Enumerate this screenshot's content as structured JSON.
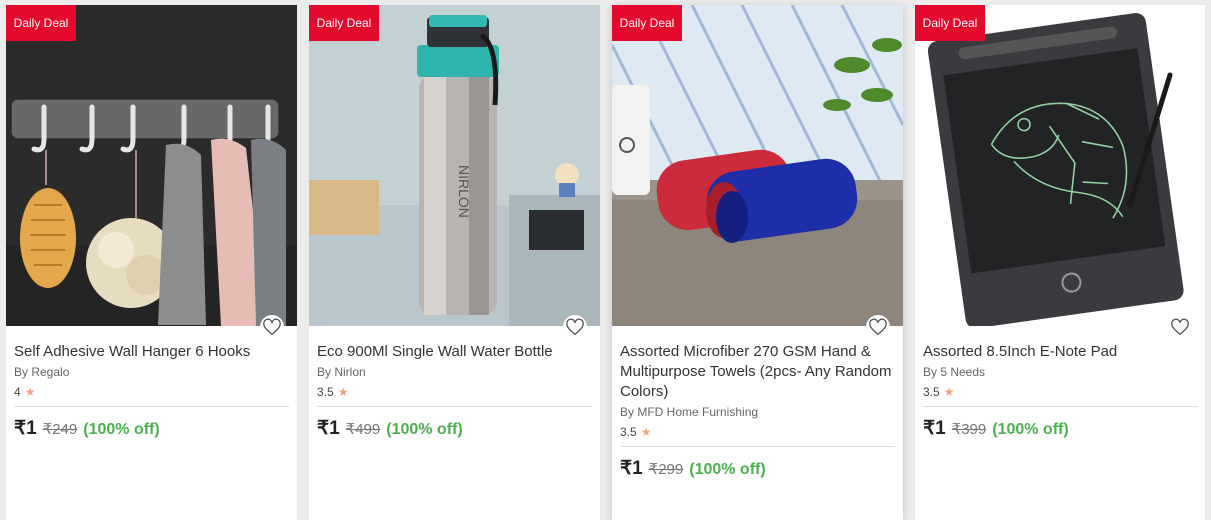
{
  "badge_label": "Daily Deal",
  "currency": "₹",
  "colors": {
    "badge": "#e40a2d",
    "discount": "#4caf50",
    "star": "#f2a37a"
  },
  "products": [
    {
      "title": "Self Adhesive Wall Hanger 6 Hooks",
      "brand": "By Regalo",
      "rating": "4",
      "price": "₹1",
      "mrp": "₹249",
      "discount": "(100% off)"
    },
    {
      "title": "Eco 900Ml Single Wall Water Bottle",
      "brand": "By Nirlon",
      "rating": "3.5",
      "price": "₹1",
      "mrp": "₹499",
      "discount": "(100% off)"
    },
    {
      "title": "Assorted Microfiber 270 GSM Hand & Multipurpose Towels (2pcs- Any Random Colors)",
      "brand": "By MFD Home Furnishing",
      "rating": "3.5",
      "price": "₹1",
      "mrp": "₹299",
      "discount": "(100% off)"
    },
    {
      "title": "Assorted 8.5Inch E-Note Pad",
      "brand": "By 5 Needs",
      "rating": "3.5",
      "price": "₹1",
      "mrp": "₹399",
      "discount": "(100% off)"
    }
  ]
}
